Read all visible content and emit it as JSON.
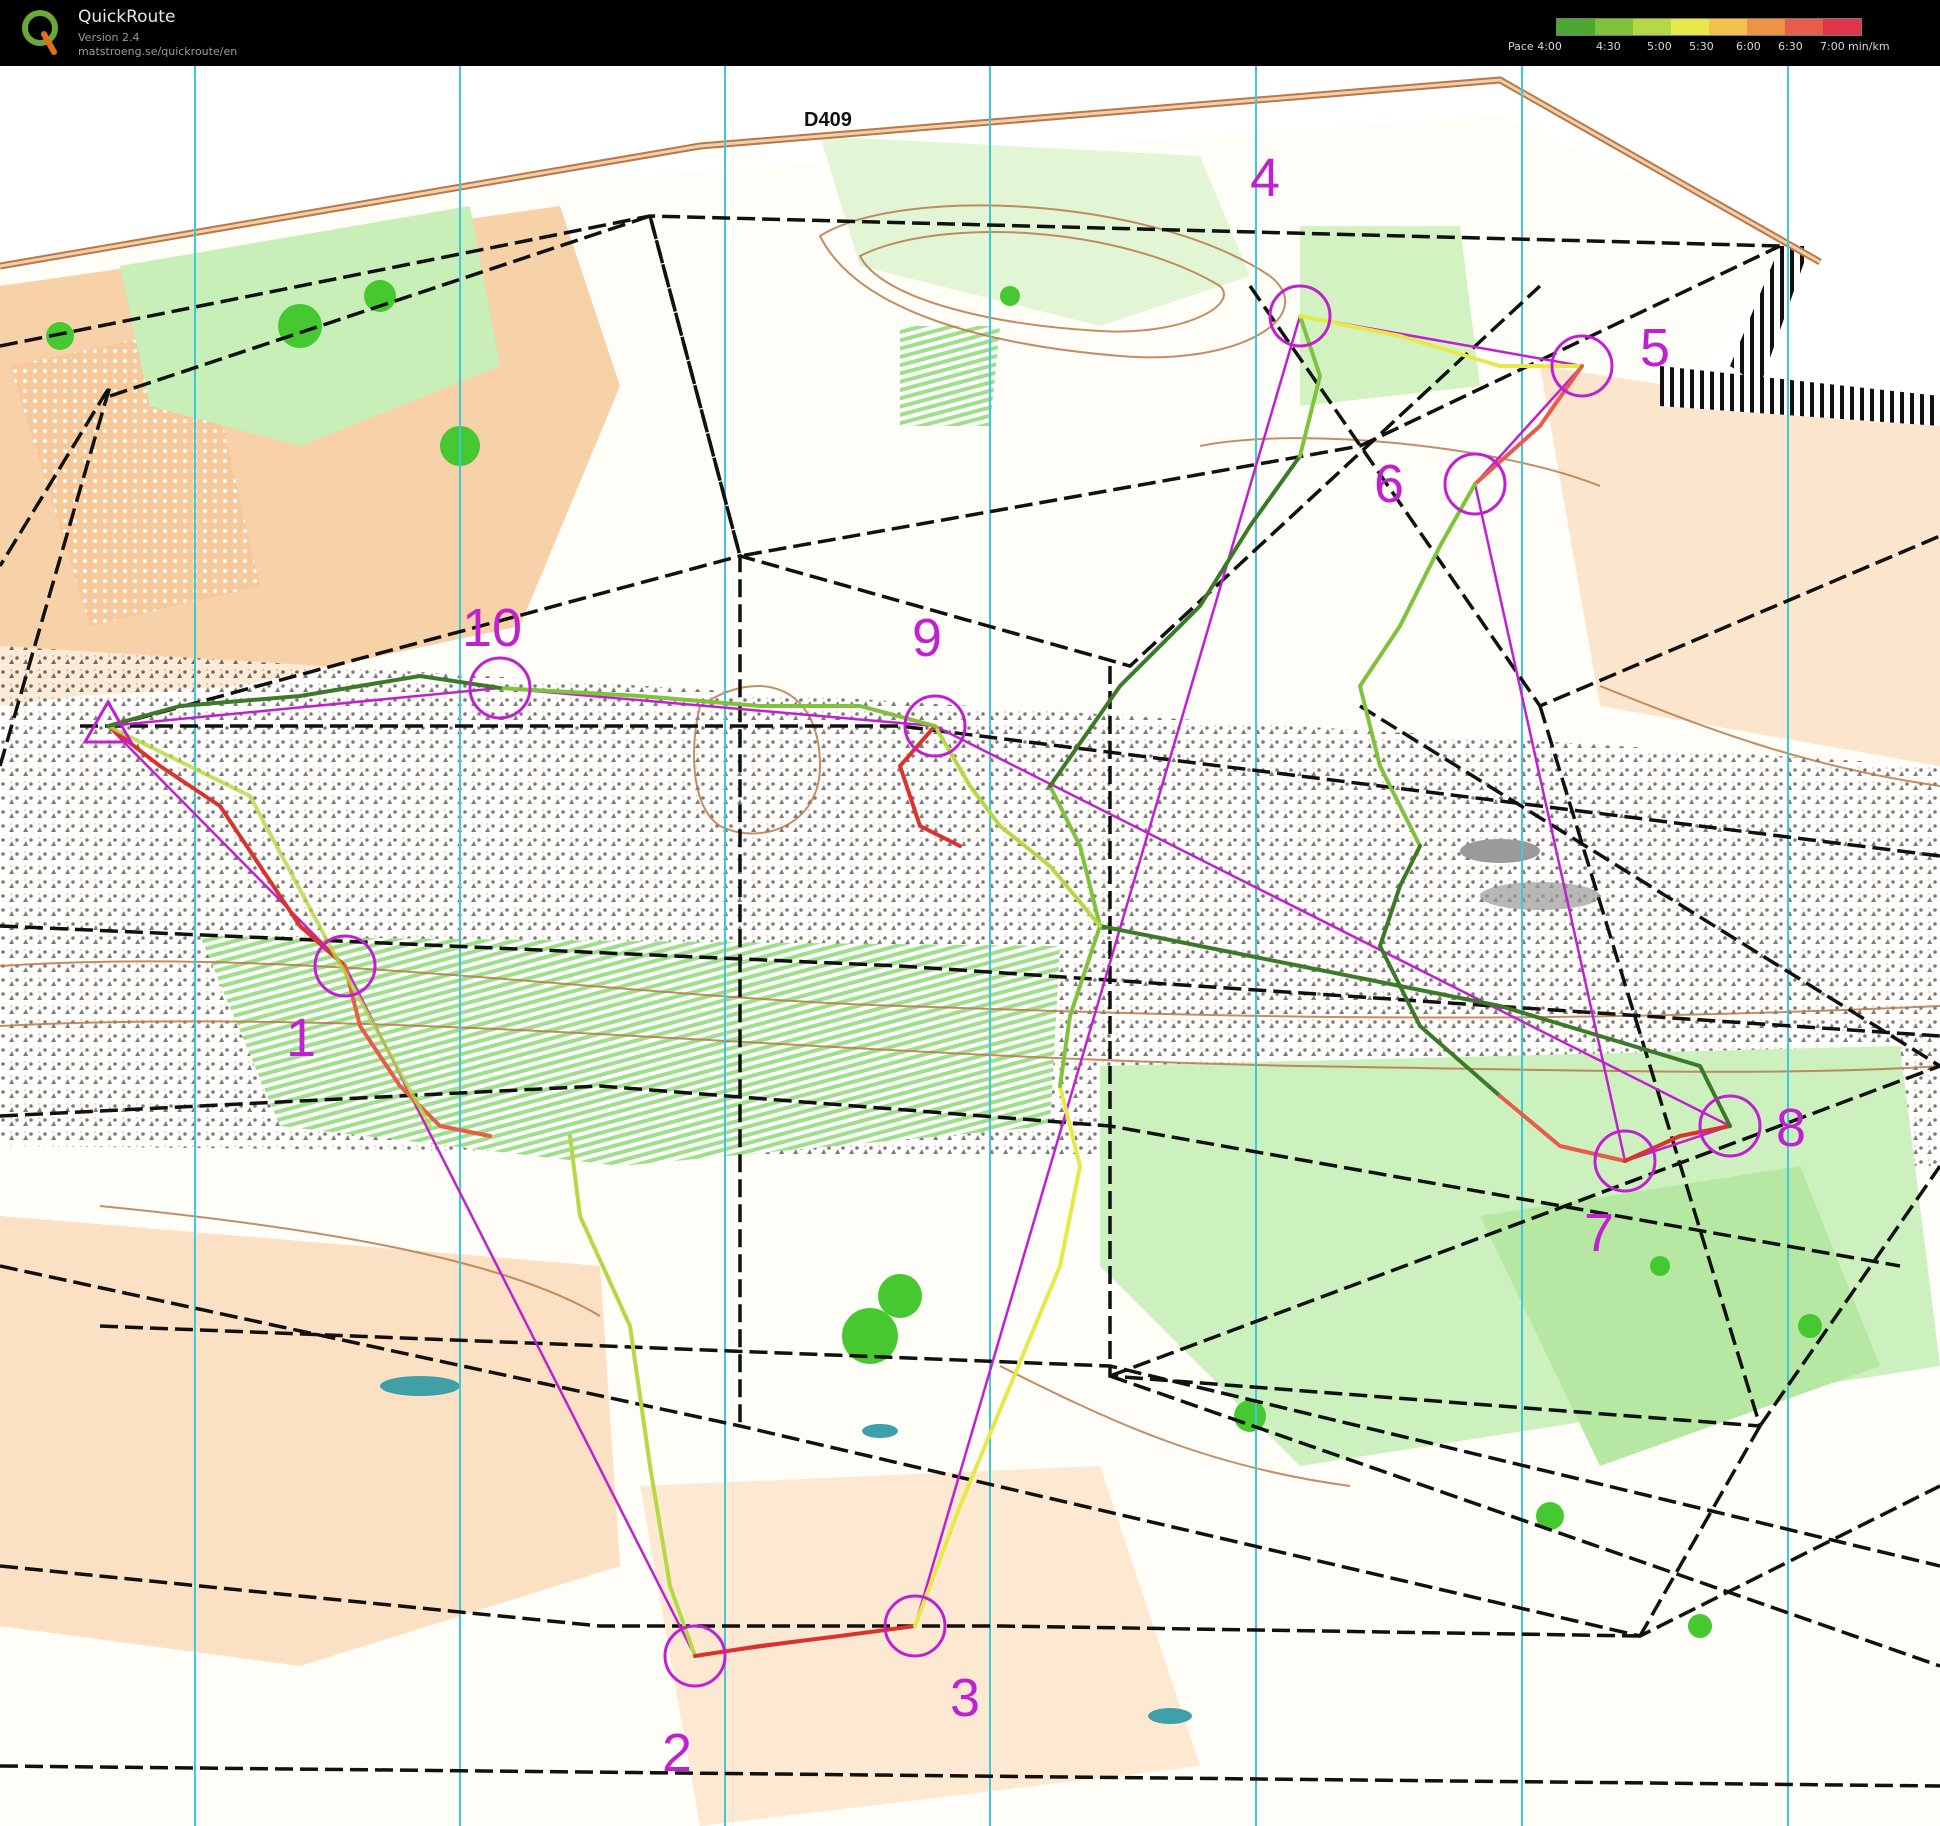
{
  "app": {
    "title": "QuickRoute",
    "version": "Version 2.4",
    "url": "matstroeng.se/quickroute/en"
  },
  "pace_legend": {
    "labels": [
      "Pace 4:00",
      "4:30",
      "5:00",
      "5:30",
      "6:00",
      "6:30",
      "7:00",
      "min/km"
    ],
    "colors": [
      "#4aa832",
      "#7fc23c",
      "#b5d844",
      "#e7e84a",
      "#f2c24a",
      "#ee9245",
      "#e85c4a",
      "#e0344a"
    ]
  },
  "map": {
    "road_label": "D409",
    "controls": [
      {
        "label": "1"
      },
      {
        "label": "2"
      },
      {
        "label": "3"
      },
      {
        "label": "4"
      },
      {
        "label": "5"
      },
      {
        "label": "6"
      },
      {
        "label": "7"
      },
      {
        "label": "8"
      },
      {
        "label": "9"
      },
      {
        "label": "10"
      }
    ],
    "colors": {
      "course": "#c020d0",
      "route_fast": "#3c7a2a",
      "route_slow": "#d8332c",
      "road": "#b87a4a",
      "vegetation": "#7ed66a",
      "open_land": "#f7c99a",
      "meridian": "#3fc8d8",
      "paths": "#111111"
    }
  }
}
